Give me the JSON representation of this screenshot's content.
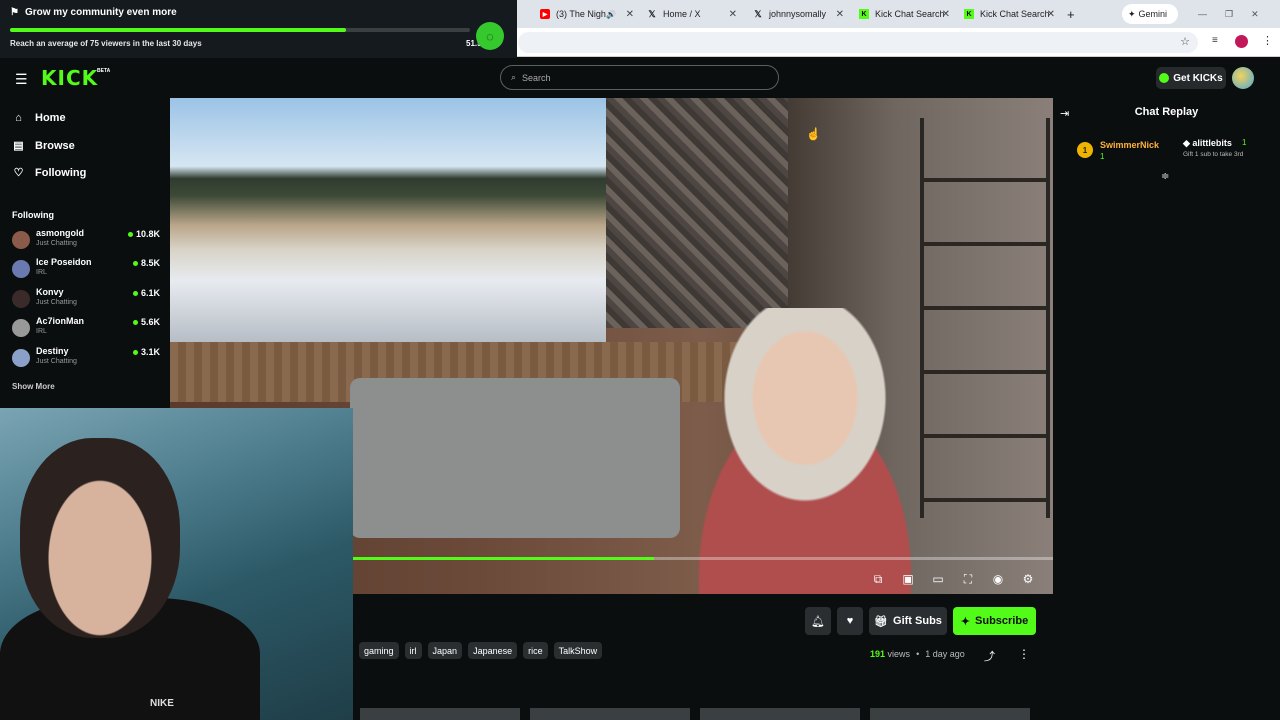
{
  "browser": {
    "tabs": [
      {
        "label": "(3) The Nigh",
        "icon": "youtube-icon",
        "color": "#ff0000"
      },
      {
        "label": "Home / X",
        "icon": "x-icon",
        "color": "#000000"
      },
      {
        "label": "johnnysomally",
        "icon": "x-icon",
        "color": "#000000"
      },
      {
        "label": "Kick Chat Search",
        "icon": "kick-icon",
        "color": "#53fc18"
      },
      {
        "label": "Kick Chat Search",
        "icon": "kick-icon",
        "color": "#53fc18"
      }
    ],
    "new_tab": "+",
    "gemini_label": "Gemini"
  },
  "goal": {
    "title": "Grow my community even more",
    "subtitle": "Reach an average of 75 viewers in the last 30 days",
    "progress_pct": 73,
    "percent_text": "51.5"
  },
  "nav": {
    "logo": "KICK",
    "beta": "BETA",
    "search_placeholder": "Search",
    "get_kicks": "Get KICKs"
  },
  "sidebar": {
    "items": [
      {
        "label": "Home",
        "icon": "home-icon"
      },
      {
        "label": "Browse",
        "icon": "browse-icon"
      },
      {
        "label": "Following",
        "icon": "heart-icon"
      }
    ],
    "following_heading": "Following",
    "following": [
      {
        "name": "asmongold",
        "category": "Just Chatting",
        "viewers": "10.8K"
      },
      {
        "name": "Ice Poseidon",
        "category": "IRL",
        "viewers": "8.5K"
      },
      {
        "name": "Konvy",
        "category": "Just Chatting",
        "viewers": "6.1K"
      },
      {
        "name": "Ac7ionMan",
        "category": "IRL",
        "viewers": "5.6K"
      },
      {
        "name": "Destiny",
        "category": "Just Chatting",
        "viewers": "3.1K"
      }
    ],
    "show_more": "Show More"
  },
  "video": {
    "progress_pct": 43,
    "brand_on_shirt": "NIKE"
  },
  "actions": {
    "gift_subs": "Gift Subs",
    "subscribe": "Subscribe"
  },
  "tags": [
    "gaming",
    "irl",
    "Japan",
    "Japanese",
    "rice",
    "TalkShow"
  ],
  "meta": {
    "views_count": "191",
    "views_label": "views",
    "separator": "•",
    "age": "1 day ago"
  },
  "chat": {
    "title": "Chat Replay",
    "top_supporter": {
      "rank": "1",
      "name": "SwimmerNick",
      "count": "1"
    },
    "top_gifter": {
      "name": "alittlebits",
      "count": "1",
      "message": "Gift 1 sub to take 3rd"
    }
  },
  "colors": {
    "accent": "#53fc18",
    "background": "#0b0e0f"
  }
}
